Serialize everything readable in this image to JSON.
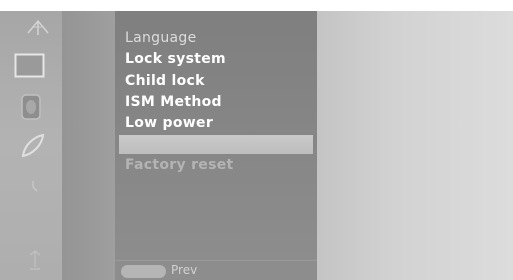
{
  "sidebar": {
    "icons": [
      "antenna-icon",
      "picture-icon",
      "sound-icon",
      "setup-icon",
      "timer-icon",
      "input-icon"
    ]
  },
  "menu": {
    "items": [
      {
        "label": "Language",
        "state": "dim"
      },
      {
        "label": "Lock system",
        "state": "bold"
      },
      {
        "label": "Child lock",
        "state": "bold"
      },
      {
        "label": "ISM Method",
        "state": "bold"
      },
      {
        "label": "Low power",
        "state": "bold"
      },
      {
        "label": "",
        "state": "highlight"
      },
      {
        "label": "Factory reset",
        "state": "disabled"
      }
    ],
    "footer": {
      "prev_label": "Prev"
    }
  },
  "colors": {
    "panel": "#858585",
    "highlight": "#c4c4c4",
    "text_bold": "#ffffff",
    "text_dim": "#dcdcdc"
  }
}
